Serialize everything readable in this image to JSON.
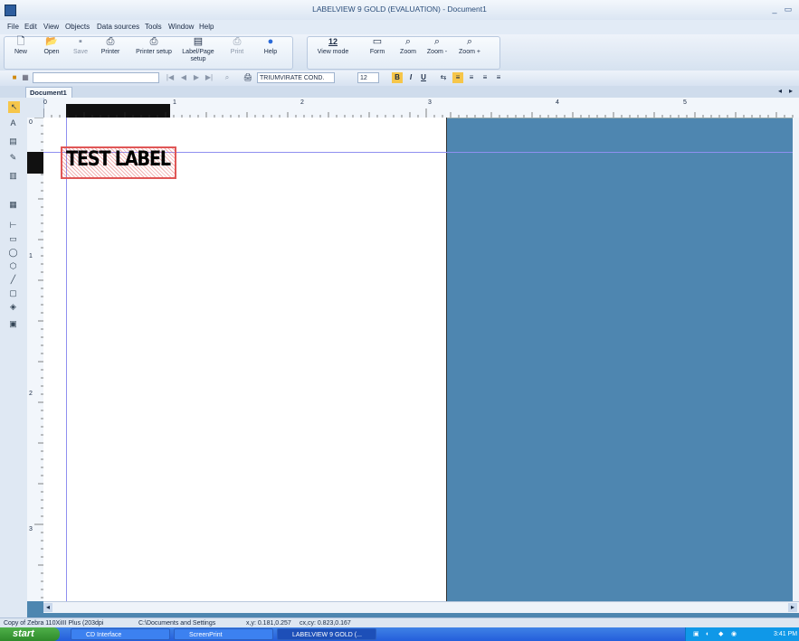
{
  "window": {
    "title": "LABELVIEW 9 GOLD (EVALUATION) - Document1",
    "controls": {
      "minimize": "_",
      "restore": "▭"
    }
  },
  "menu": [
    "File",
    "Edit",
    "View",
    "Objects",
    "Data sources",
    "Tools",
    "Window",
    "Help"
  ],
  "ribbon": {
    "file_group": [
      {
        "label": "New",
        "icon": "new-icon",
        "enabled": true
      },
      {
        "label": "Open",
        "icon": "folder-open-icon",
        "enabled": true
      },
      {
        "label": "Save",
        "icon": "save-icon",
        "enabled": false
      },
      {
        "label": "Printer",
        "icon": "printer-icon",
        "enabled": true
      },
      {
        "label": "Printer setup",
        "icon": "printer-setup-icon",
        "enabled": true
      },
      {
        "label": "Label/Page setup",
        "icon": "label-page-setup-icon",
        "enabled": true
      },
      {
        "label": "Print",
        "icon": "print-icon",
        "enabled": false
      },
      {
        "label": "Help",
        "icon": "help-icon",
        "enabled": true
      }
    ],
    "view_group": [
      {
        "label": "View mode",
        "icon": "view-mode-icon",
        "value": "12"
      },
      {
        "label": "Form",
        "icon": "form-icon"
      },
      {
        "label": "Zoom",
        "icon": "zoom-icon"
      },
      {
        "label": "Zoom -",
        "icon": "zoom-out-icon"
      },
      {
        "label": "Zoom +",
        "icon": "zoom-in-icon"
      }
    ]
  },
  "format_toolbar": {
    "font_name": "TRIUMVIRATE COND.",
    "font_size": "12",
    "bold": "B",
    "italic": "I",
    "underline": "U"
  },
  "tabs": {
    "document": "Document1"
  },
  "rulers": {
    "h_ticks": [
      "0",
      "1",
      "2",
      "3",
      "4",
      "5"
    ],
    "v_ticks": [
      "0",
      "1",
      "2",
      "3"
    ]
  },
  "label_object": {
    "text": "TEST LABEL"
  },
  "status": {
    "printer": "Copy of Zebra 110XiIII Plus (203dpi",
    "path": "C:\\Documents and Settings",
    "xy": "x,y: 0.181,0.257",
    "cxcy": "cx,cy: 0.823,0.167"
  },
  "taskbar": {
    "start": "start",
    "items": [
      "CD Interface",
      "ScreenPrint",
      "LABELVIEW 9 GOLD (..."
    ],
    "clock": "3:41 PM"
  },
  "colors": {
    "workspace": "#4e86b0",
    "selection": "#e05656",
    "guide": "#8f8ff0",
    "taskbar": "#245edb"
  }
}
